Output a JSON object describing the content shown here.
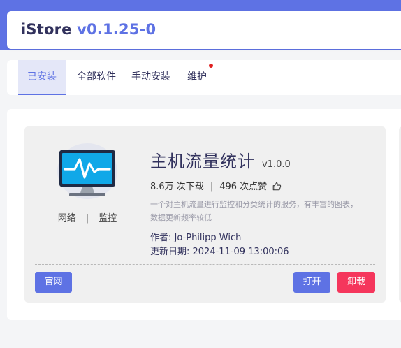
{
  "header": {
    "title": "iStore",
    "version": "v0.1.25-0"
  },
  "tabs": [
    {
      "label": "已安装",
      "active": true
    },
    {
      "label": "全部软件",
      "active": false
    },
    {
      "label": "手动安装",
      "active": false
    },
    {
      "label": "维护",
      "active": false,
      "notification_dot": true
    }
  ],
  "app": {
    "name": "主机流量统计",
    "version": "v1.0.0",
    "icon": "monitor-pulse-icon",
    "downloads": "8.6万 次下载",
    "likes": "496 次点赞",
    "likes_icon": "thumbs-up-icon",
    "tags": [
      "网络",
      "监控"
    ],
    "tag_separator": "|",
    "stats_separator": "|",
    "description": "一个对主机流量进行监控和分类统计的服务，有丰富的图表，数据更新频率较低",
    "author": "作者: Jo-Philipp Wich",
    "updated": "更新日期: 2024-11-09 13:00:06"
  },
  "actions": {
    "website": "官网",
    "open": "打开",
    "uninstall": "卸载"
  },
  "colors": {
    "accent": "#5e72e4",
    "danger": "#f5365c",
    "notification": "#e02020",
    "icon_screen": "#10a8e8",
    "icon_frame": "#1f2a44"
  }
}
